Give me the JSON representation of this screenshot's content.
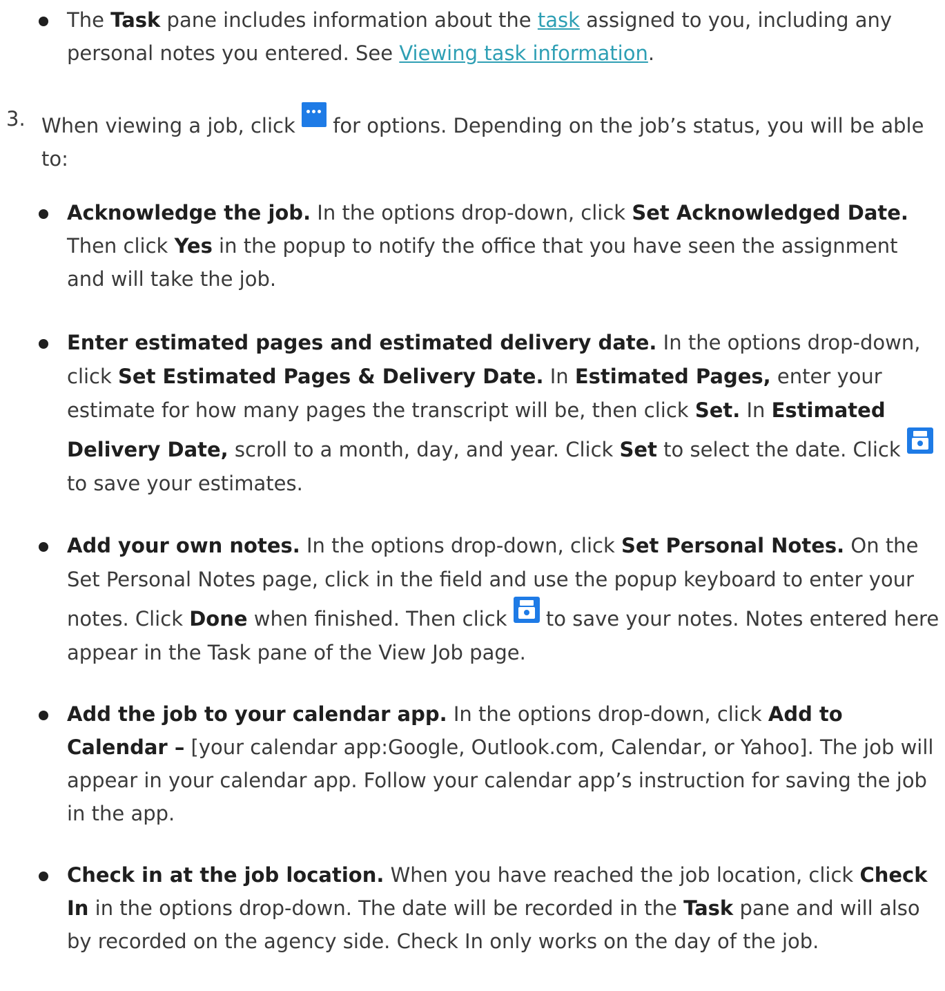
{
  "task_pane": {
    "bold": "Task",
    "text_1": " pane includes information about the ",
    "link_task": "task",
    "text_2": " assigned to you, including any personal notes you entered. See ",
    "link_viewing": "Viewing task information",
    "text_3": "."
  },
  "step3": {
    "number": "3.",
    "text_1": "When viewing a job, click ",
    "icon": "more-options-icon",
    "text_2": " for options. Depending on the job’s status, you will be able to:"
  },
  "items": {
    "acknowledge": {
      "title": "Acknowledge the job.",
      "t1": " In the options drop-down, click ",
      "b1": "Set Acknowledged Date.",
      "t2": " Then click ",
      "b2": "Yes",
      "t3": " in the popup to notify the office that you have seen the assignment and will take the job."
    },
    "estimate": {
      "title": "Enter estimated pages and estimated delivery date.",
      "t1": " In the options drop-down, click ",
      "b1": "Set Estimated Pages & Delivery Date.",
      "t2": " In ",
      "b2": "Estimated Pages,",
      "t3": " enter your estimate for how many pages the transcript will be, then click ",
      "b3": "Set.",
      "t4": " In ",
      "b4": "Estimated Delivery Date,",
      "t5": " scroll to a month, day, and year. Click ",
      "b5": "Set",
      "t6": " to select the date. Click ",
      "icon": "save-icon",
      "t7": " to save your estimates."
    },
    "notes": {
      "title": "Add your own notes.",
      "t1": " In the options drop-down, click ",
      "b1": "Set Personal Notes.",
      "t2": " On the Set Personal Notes page, click in the field and use the popup keyboard to enter your notes. Click ",
      "b2": "Done",
      "t3": " when finished. Then click ",
      "icon": "save-icon",
      "t4": " to save your notes. Notes entered here appear in the Task pane of the View Job page."
    },
    "calendar": {
      "title": "Add the job to your calendar app.",
      "t1": " In the options drop-down, click ",
      "b1": "Add to Calendar –",
      "t2": " [your calendar app:Google, Outlook.com, Calendar, or Yahoo]. The job will appear in your calendar app. Follow your calendar app’s instruction for saving the job in the app."
    },
    "checkin": {
      "title": "Check in at the job location.",
      "t1": " When you have reached the job location, click ",
      "b1": "Check In",
      "t2": " in the options drop-down. The date will be recorded in the ",
      "b2": "Task",
      "t3": " pane and will also by recorded on the agency side. Check In only works on the day of the job."
    }
  },
  "colors": {
    "text": "#3a3a3a",
    "bold_text": "#1f1f1f",
    "link": "#2e9fb4",
    "icon_bg": "#1e7be6"
  }
}
